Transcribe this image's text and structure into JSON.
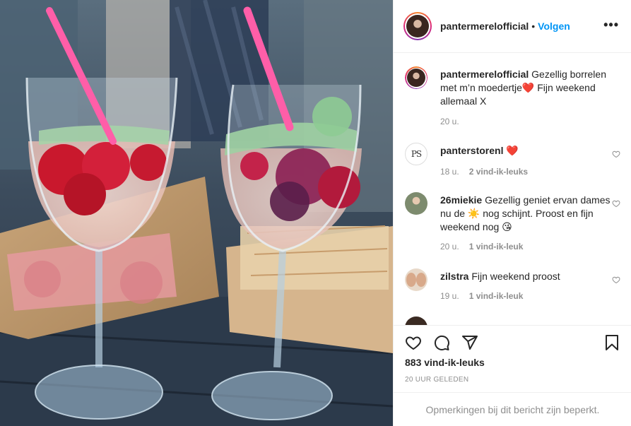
{
  "photo": {
    "description_icon": "post-photo"
  },
  "header": {
    "username": "pantermerelofficial",
    "separator": "•",
    "follow_label": "Volgen",
    "more_label": "•••"
  },
  "caption": {
    "username": "pantermerelofficial",
    "text": "Gezellig borrelen met m’n moedertje❤️ Fijn weekend allemaal X",
    "time": "20 u."
  },
  "comments": [
    {
      "username": "panterstorenl",
      "text": "❤️",
      "time": "18 u.",
      "likes": "2 vind-ik-leuks",
      "avatar_text": "PS"
    },
    {
      "username": "26miekie",
      "text": "Gezellig geniet ervan dames nu de ☀️ nog schijnt. Proost en fijn weekend nog 😘",
      "time": "20 u.",
      "likes": "1 vind-ik-leuk"
    },
    {
      "username": "zilstra",
      "text": "Fijn weekend proost",
      "time": "19 u.",
      "likes": "1 vind-ik-leuk"
    }
  ],
  "actions": {
    "like_icon": "heart-icon",
    "comment_icon": "comment-icon",
    "share_icon": "paper-plane-icon",
    "save_icon": "bookmark-icon"
  },
  "likes_count": "883 vind-ik-leuks",
  "timestamp": "20 UUR GELEDEN",
  "comments_restricted": "Opmerkingen bij dit bericht zijn beperkt.",
  "colors": {
    "accent": "#0095f6",
    "muted": "#8e8e8e",
    "text": "#262626",
    "border": "#efefef"
  }
}
